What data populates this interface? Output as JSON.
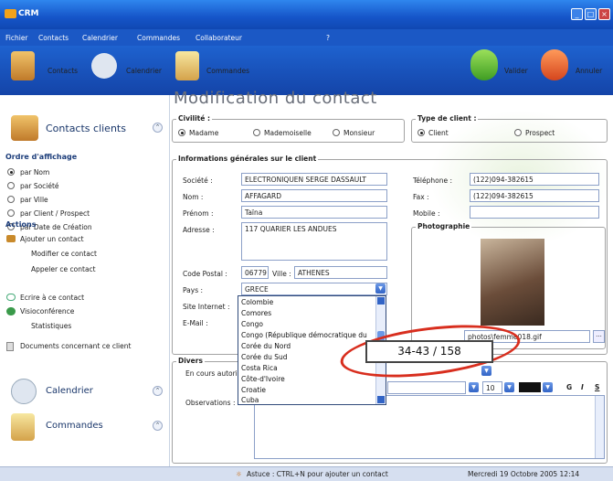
{
  "app": {
    "title": "CRM"
  },
  "menu": [
    "Fichier",
    "Contacts",
    "Calendrier",
    "Commandes",
    "Collaborateur",
    "?"
  ],
  "toolbar": {
    "contacts": "Contacts",
    "calendrier": "Calendrier",
    "commandes": "Commandes",
    "valider": "Valider",
    "annuler": "Annuler"
  },
  "sidebar": {
    "contacts_title": "Contacts clients",
    "order_title": "Ordre d'affichage",
    "order_items": [
      "par Nom",
      "par Société",
      "par Ville",
      "par Client / Prospect",
      "par Date de Création"
    ],
    "actions_title": "Actions",
    "actions": [
      "Ajouter un contact",
      "Modifier ce contact",
      "Appeler ce contact",
      "Ecrire à ce contact",
      "Visioconférence",
      "Statistiques",
      "Documents concernant ce client"
    ],
    "calendrier": "Calendrier",
    "commandes": "Commandes"
  },
  "page": {
    "title": "Modification du contact"
  },
  "civilite": {
    "title": "Civilité :",
    "options": [
      "Madame",
      "Mademoiselle",
      "Monsieur"
    ],
    "selected": "Madame"
  },
  "type_client": {
    "title": "Type de client :",
    "options": [
      "Client",
      "Prospect"
    ],
    "selected": "Client"
  },
  "info": {
    "title": "Informations générales sur le client",
    "societe_label": "Société :",
    "societe": "ELECTRONIQUEN SERGE DASSAULT",
    "nom_label": "Nom :",
    "nom": "AFFAGARD",
    "prenom_label": "Prénom :",
    "prenom": "Taïna",
    "adresse_label": "Adresse :",
    "adresse": "117 QUARIER LES ANDUES",
    "cp_label": "Code Postal :",
    "cp": "06779",
    "ville_label": "Ville :",
    "ville": "ATHENES",
    "pays_label": "Pays :",
    "pays": "GRECE",
    "site_label": "Site Internet :",
    "email_label": "E-Mail :",
    "tel_label": "Téléphone :",
    "tel": "(122)094-382615",
    "fax_label": "Fax :",
    "fax": "(122)094-382615",
    "mobile_label": "Mobile :",
    "photo_title": "Photographie",
    "photo_path": "photos\\femme018.gif",
    "browse": "..."
  },
  "dropdown_items": [
    "Colombie",
    "Comores",
    "Congo",
    "Congo (République démocratique du",
    "Corée du Nord",
    "Corée du Sud",
    "Costa Rica",
    "Côte-d'Ivoire",
    "Croatie",
    "Cuba"
  ],
  "divers": {
    "title": "Divers",
    "encours_label": "En cours autori",
    "obs_label": "Observations :",
    "font_size": "10",
    "bold": "G",
    "italic": "I",
    "underline": "S"
  },
  "tooltip": "34-43 / 158",
  "status": {
    "tip": "Astuce : CTRL+N pour ajouter un contact",
    "date": "Mercredi 19 Octobre 2005 12:14"
  },
  "colors": {
    "titlebar": "#1554c8",
    "accent": "#d82e1e"
  }
}
